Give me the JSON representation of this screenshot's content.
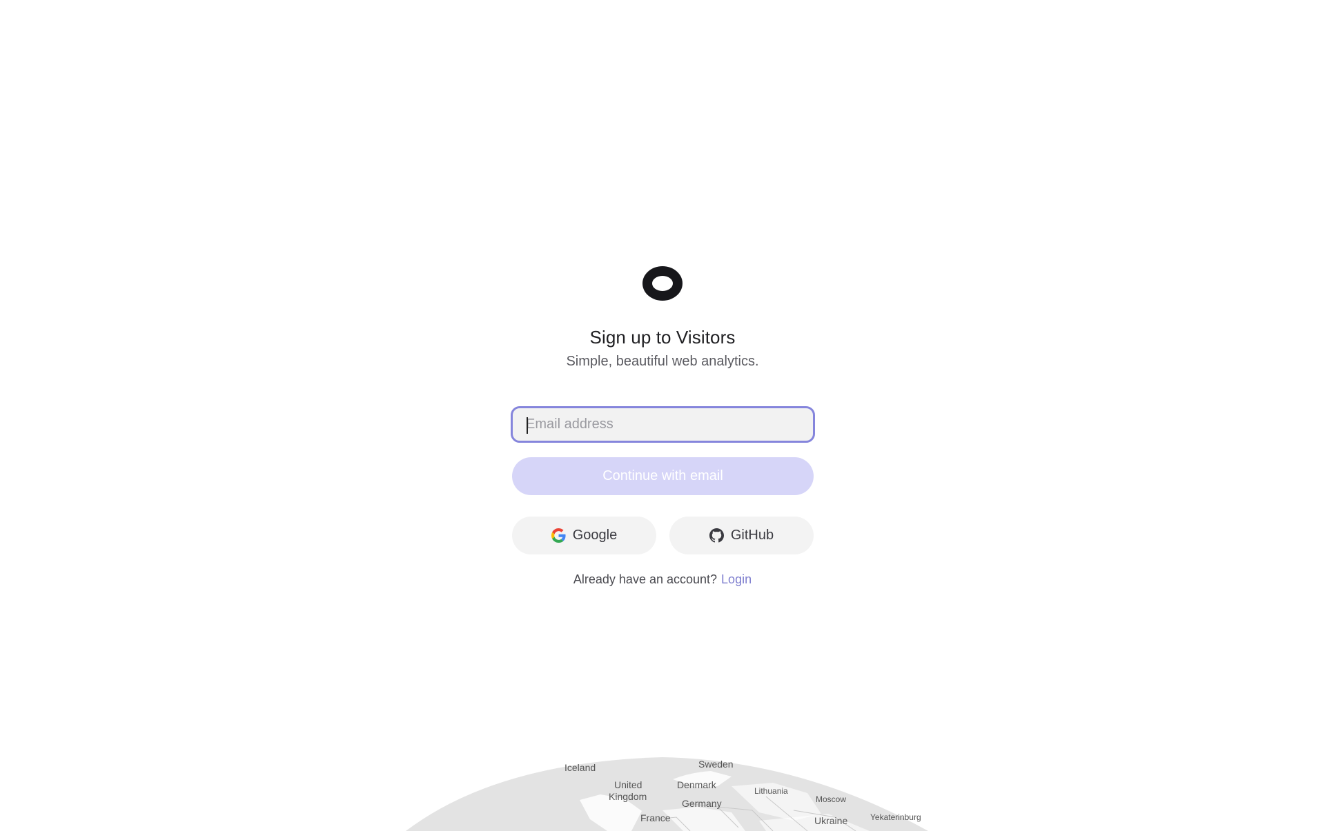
{
  "app": {
    "title": "Sign up to Visitors",
    "subtitle": "Simple, beautiful web analytics."
  },
  "form": {
    "email_placeholder": "Email address",
    "email_value": "",
    "continue_label": "Continue with email"
  },
  "social": {
    "google_label": "Google",
    "github_label": "GitHub"
  },
  "footer": {
    "prompt": "Already have an account?",
    "login_label": "Login"
  },
  "map_labels": {
    "iceland": "Iceland",
    "sweden": "Sweden",
    "united_kingdom_1": "United",
    "united_kingdom_2": "Kingdom",
    "denmark": "Denmark",
    "lithuania": "Lithuania",
    "moscow": "Moscow",
    "germany": "Germany",
    "france": "France",
    "ukraine": "Ukraine",
    "yekaterinburg": "Yekaterinburg"
  },
  "colors": {
    "accent": "#8585dc",
    "accent_light": "#d6d5f8",
    "link": "#7f7fcf",
    "globe": "#e2e2e2"
  },
  "icons": {
    "logo": "visitors-logo-icon",
    "google": "google-icon",
    "github": "github-icon"
  }
}
